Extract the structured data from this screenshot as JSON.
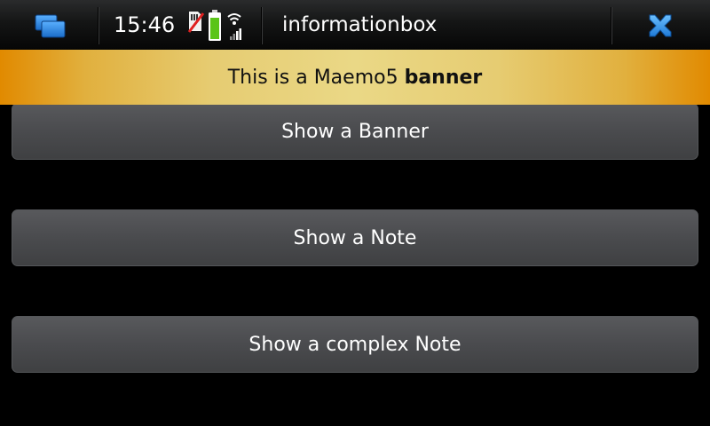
{
  "status_bar": {
    "time": "15:46",
    "icons": [
      "task-switcher-icon",
      "sim-card-icon",
      "battery-icon",
      "wifi-signal-icon",
      "close-icon"
    ]
  },
  "window": {
    "title": "informationbox"
  },
  "banner": {
    "text_regular": "This is a Maemo5 ",
    "text_bold": "banner"
  },
  "buttons": [
    {
      "label": "Show a Banner"
    },
    {
      "label": "Show a Note"
    },
    {
      "label": "Show a complex Note"
    }
  ],
  "colors": {
    "background": "#000000",
    "banner_edge": "#e18a00",
    "banner_center": "#ead886",
    "button_face": "#4a4b4e",
    "close_icon": "#2f8de0",
    "battery": "#5ac418"
  }
}
